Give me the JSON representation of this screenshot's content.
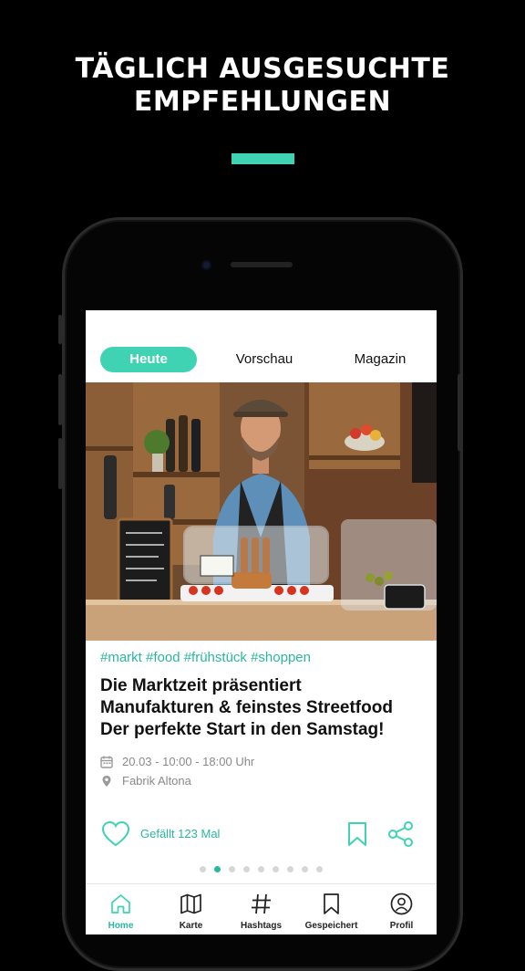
{
  "promo": {
    "headline_line1": "TÄGLICH AUSGESUCHTE",
    "headline_line2": "EMPFEHLUNGEN"
  },
  "colors": {
    "accent": "#3fd3b4",
    "accent_text": "#29b89e",
    "background": "#000000"
  },
  "tabs": [
    {
      "label": "Heute",
      "active": true
    },
    {
      "label": "Vorschau",
      "active": false
    },
    {
      "label": "Magazin",
      "active": false
    }
  ],
  "card": {
    "image": "photo-market-vendor",
    "hashtags": "#markt #food #frühstück #shoppen",
    "title_lines": [
      "Die Marktzeit präsentiert",
      "Manufakturen & feinstes Streetfood",
      "Der perfekte Start in den Samstag!"
    ],
    "date": "20.03 - 10:00 - 18:00 Uhr",
    "location": "Fabrik Altona",
    "likes": "Gefällt 123 Mal"
  },
  "pagination": {
    "count": 9,
    "active_index": 1
  },
  "tabbar": [
    {
      "label": "Home",
      "icon": "home-icon",
      "active": true
    },
    {
      "label": "Karte",
      "icon": "map-icon",
      "active": false
    },
    {
      "label": "Hashtags",
      "icon": "hashtag-icon",
      "active": false
    },
    {
      "label": "Gespeichert",
      "icon": "bookmark-icon",
      "active": false
    },
    {
      "label": "Profil",
      "icon": "profile-icon",
      "active": false
    }
  ]
}
